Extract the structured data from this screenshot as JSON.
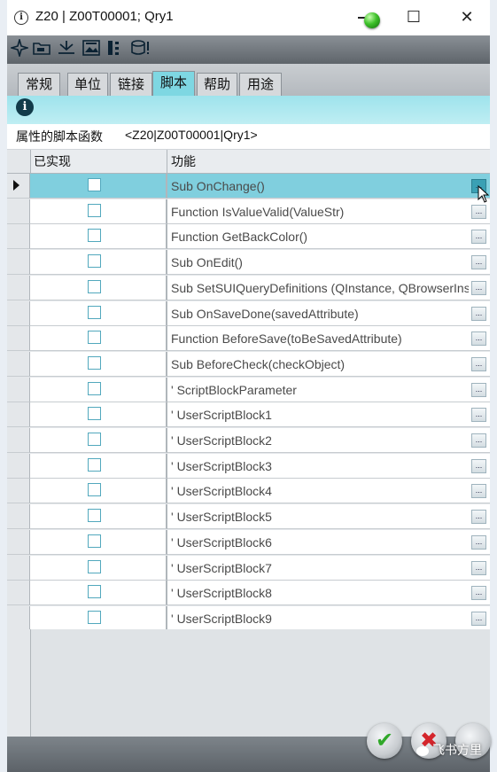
{
  "window": {
    "title": "Z20 | Z00T00001; Qry1",
    "minimize": "—",
    "maximize": "☐",
    "close": "✕"
  },
  "toolbar": {
    "icons": [
      "navigate-icon",
      "folder-icon",
      "tree-icon",
      "picture-icon",
      "columns-icon",
      "database-icon"
    ]
  },
  "tabs": [
    {
      "label": "常规"
    },
    {
      "label": "单位"
    },
    {
      "label": "链接"
    },
    {
      "label": "脚本",
      "active": true
    },
    {
      "label": "帮助"
    },
    {
      "label": "用途"
    }
  ],
  "subhead": {
    "label": "属性的脚本函数",
    "value": "<Z20|Z00T00001|Qry1>"
  },
  "grid": {
    "headers": {
      "implemented": "已实现",
      "function": "功能"
    },
    "ellipsis": "...",
    "rows": [
      {
        "func": "Sub OnChange()",
        "checked": false,
        "selected": true
      },
      {
        "func": "Function IsValueValid(ValueStr)",
        "checked": false
      },
      {
        "func": "Function GetBackColor()",
        "checked": false
      },
      {
        "func": "Sub OnEdit()",
        "checked": false
      },
      {
        "func": "Sub SetSUIQueryDefinitions (QInstance, QBrowserInst",
        "checked": false
      },
      {
        "func": "Sub OnSaveDone(savedAttribute)",
        "checked": false
      },
      {
        "func": "Function BeforeSave(toBeSavedAttribute)",
        "checked": false
      },
      {
        "func": "Sub BeforeCheck(checkObject)",
        "checked": false
      },
      {
        "func": "' ScriptBlockParameter",
        "checked": false
      },
      {
        "func": "' UserScriptBlock1",
        "checked": false
      },
      {
        "func": "' UserScriptBlock2",
        "checked": false
      },
      {
        "func": "' UserScriptBlock3",
        "checked": false
      },
      {
        "func": "' UserScriptBlock4",
        "checked": false
      },
      {
        "func": "' UserScriptBlock5",
        "checked": false
      },
      {
        "func": "' UserScriptBlock6",
        "checked": false
      },
      {
        "func": "' UserScriptBlock7",
        "checked": false
      },
      {
        "func": "' UserScriptBlock8",
        "checked": false
      },
      {
        "func": "' UserScriptBlock9",
        "checked": false
      }
    ]
  },
  "footer": {
    "ok": "✔",
    "cancel": "✖",
    "watermark": "飞书方里"
  },
  "colors": {
    "accent_teal": "#7ed7e2",
    "selected_row": "#80cfde",
    "ok_green": "#31a82a",
    "cancel_red": "#d4262c"
  }
}
